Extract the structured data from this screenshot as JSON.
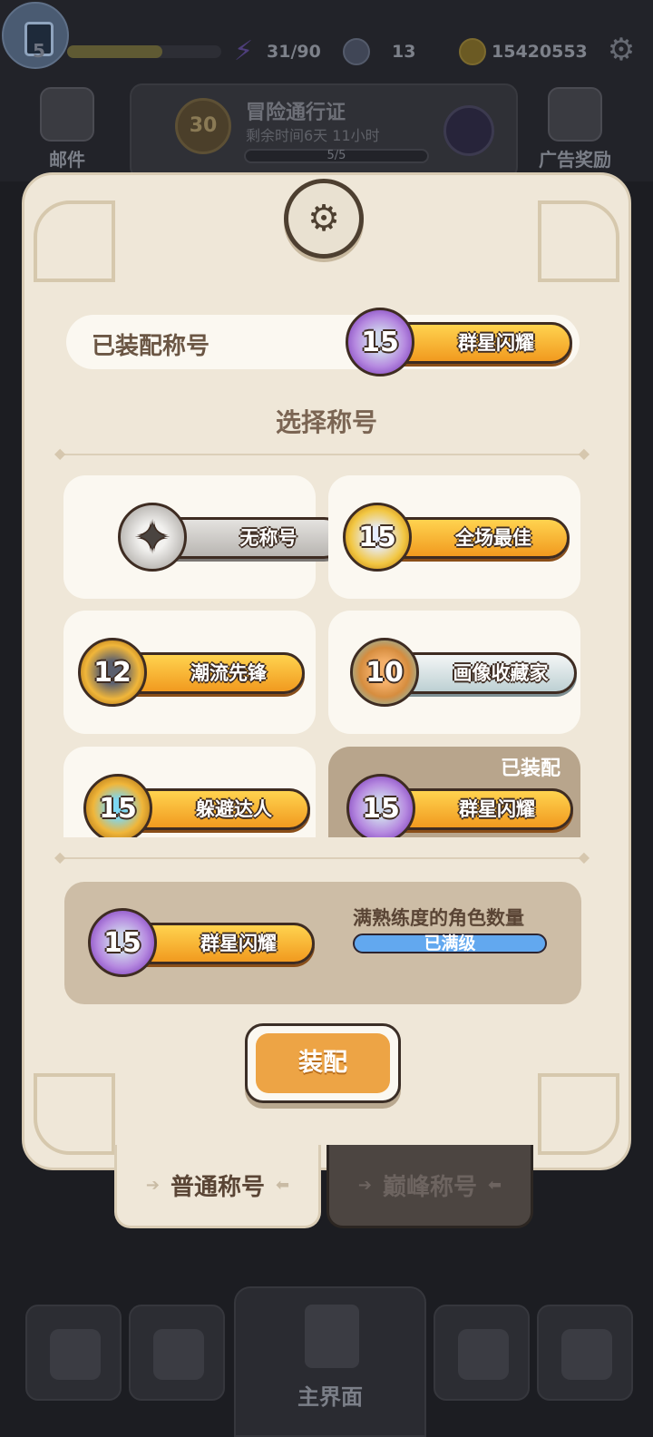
{
  "header": {
    "level": "5",
    "energy": "31/90",
    "gems": "13",
    "coins": "15420553"
  },
  "side_buttons": {
    "mail": "邮件",
    "ad_reward": "广告奖励"
  },
  "adventure_pass": {
    "level": "30",
    "title": "冒险通行证",
    "subtitle": "剩余时间6天 11小时",
    "progress": "5/5"
  },
  "panel": {
    "equipped_label": "已装配称号",
    "equipped_title": {
      "name": "群星闪耀",
      "level": "15"
    },
    "section_title": "选择称号",
    "titles": [
      {
        "name": "无称号",
        "level": "",
        "style": "gray",
        "emblem": "star-outline-icon",
        "equipped": false
      },
      {
        "name": "全场最佳",
        "level": "15",
        "style": "gold",
        "emblem": "sword-icon",
        "equipped": false
      },
      {
        "name": "潮流先锋",
        "level": "12",
        "style": "gold",
        "emblem": "helmet-icon",
        "equipped": false
      },
      {
        "name": "画像收藏家",
        "level": "10",
        "style": "silver",
        "emblem": "portrait-frame-icon",
        "equipped": false
      },
      {
        "name": "躲避达人",
        "level": "15",
        "style": "gold",
        "emblem": "dodge-icon",
        "equipped": false
      },
      {
        "name": "群星闪耀",
        "level": "15",
        "style": "gold",
        "emblem": "star-crystal-icon",
        "equipped": true
      }
    ],
    "equipped_tag": "已装配",
    "detail": {
      "title": {
        "name": "群星闪耀",
        "level": "15"
      },
      "requirement_label": "满熟练度的角色数量",
      "progress_text": "已满级"
    },
    "equip_button": "装配"
  },
  "tabs": [
    {
      "label": "普通称号",
      "active": true
    },
    {
      "label": "巅峰称号",
      "active": false
    }
  ],
  "bottom_nav": {
    "main_label": "主界面"
  },
  "colors": {
    "panel_bg": "#efe7d8",
    "card_bg": "#fbf8f1",
    "equipped_card_bg": "#b8a58c",
    "badge_gold": "#f5b43a",
    "button_orange": "#eda445",
    "progress_blue": "#62a8ef"
  }
}
